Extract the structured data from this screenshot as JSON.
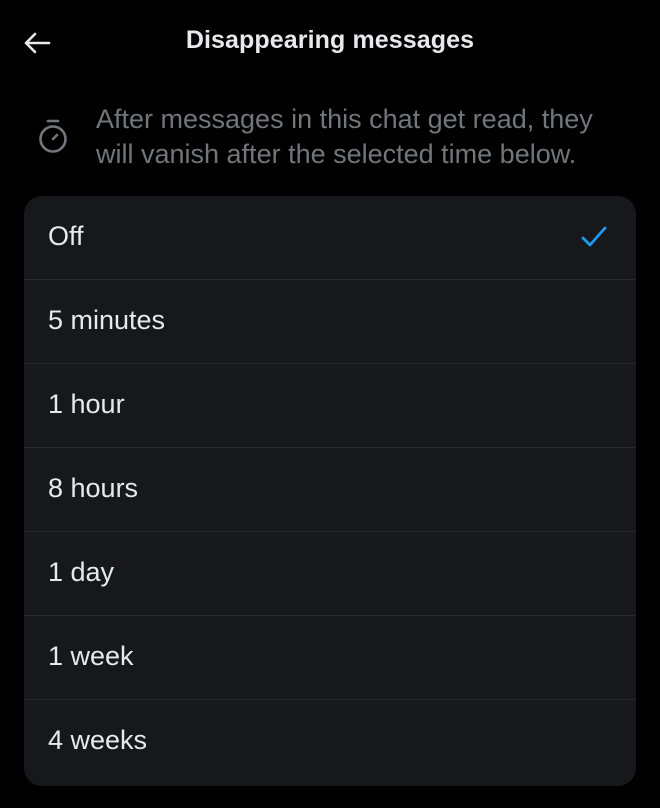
{
  "header": {
    "title": "Disappearing messages",
    "back_icon": "arrow-left-icon"
  },
  "info": {
    "icon": "timer-icon",
    "line1": "After messages in this chat get read, they",
    "line2": "will vanish after the selected time below."
  },
  "options": [
    {
      "label": "Off",
      "selected": true
    },
    {
      "label": "5 minutes",
      "selected": false
    },
    {
      "label": "1 hour",
      "selected": false
    },
    {
      "label": "8 hours",
      "selected": false
    },
    {
      "label": "1 day",
      "selected": false
    },
    {
      "label": "1 week",
      "selected": false
    },
    {
      "label": "4 weeks",
      "selected": false
    }
  ],
  "colors": {
    "background": "#000000",
    "card": "#16181c",
    "text": "#e7e9ea",
    "secondary_text": "#71767b",
    "accent": "#1d9bf0"
  }
}
